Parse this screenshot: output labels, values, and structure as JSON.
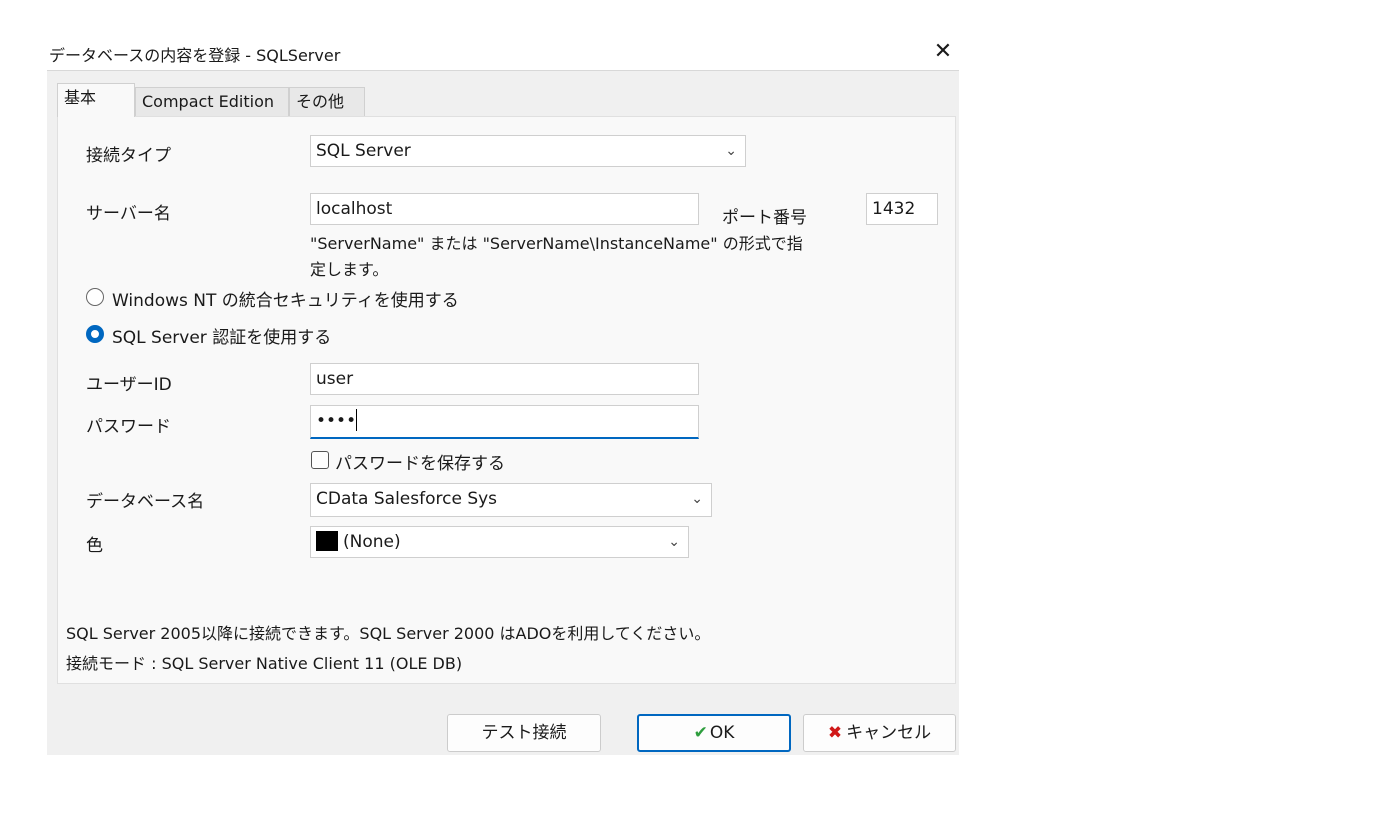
{
  "window": {
    "title": "データベースの内容を登録 - SQLServer",
    "close_glyph": "✕"
  },
  "tabs": [
    {
      "label": "基本",
      "active": true
    },
    {
      "label": "Compact Edition",
      "active": false
    },
    {
      "label": "その他",
      "active": false
    }
  ],
  "form": {
    "connection_type": {
      "label": "接続タイプ",
      "value": "SQL Server"
    },
    "server_name": {
      "label": "サーバー名",
      "value": "localhost",
      "hint_line1": "\"ServerName\" または \"ServerName\\InstanceName\" の形式で指",
      "hint_line2": "定します。"
    },
    "port": {
      "label": "ポート番号",
      "value": "1432"
    },
    "auth_windows": {
      "label": "Windows NT の統合セキュリティを使用する",
      "checked": false
    },
    "auth_sql": {
      "label": "SQL Server 認証を使用する",
      "checked": true
    },
    "user_id": {
      "label": "ユーザーID",
      "value": "user"
    },
    "password": {
      "label": "パスワード",
      "value": "••••"
    },
    "save_password": {
      "label": "パスワードを保存する",
      "checked": false
    },
    "database_name": {
      "label": "データベース名",
      "value": "CData Salesforce Sys"
    },
    "color": {
      "label": "色",
      "value": "(None)",
      "swatch": "#000000"
    }
  },
  "info": {
    "line1": "SQL Server 2005以降に接続できます。SQL Server 2000 はADOを利用してください。",
    "line2": "接続モード : SQL Server Native Client 11 (OLE DB)"
  },
  "buttons": {
    "test": "テスト接続",
    "ok": "OK",
    "ok_icon": "✔",
    "cancel": "キャンセル",
    "cancel_icon": "✖"
  },
  "colors": {
    "accent": "#0067c0",
    "ok_icon": "#2e9e3e",
    "cancel_icon": "#d01818"
  }
}
